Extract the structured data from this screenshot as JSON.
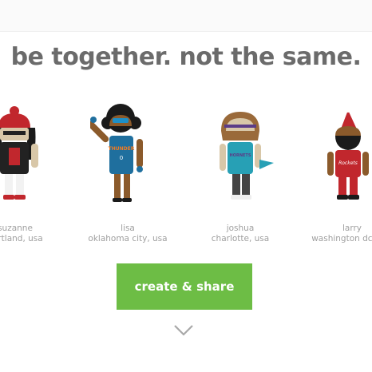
{
  "headline": "be together. not the same.",
  "characters": [
    {
      "name": "suzanne",
      "location": "portland, usa",
      "icon": "android-character-icon"
    },
    {
      "name": "lisa",
      "location": "oklahoma city, usa",
      "icon": "android-character-icon"
    },
    {
      "name": "joshua",
      "location": "charlotte, usa",
      "icon": "android-character-icon"
    },
    {
      "name": "larry",
      "location": "washington dc, usa",
      "icon": "android-character-icon"
    }
  ],
  "cta": {
    "label": "create & share"
  },
  "scroll": {
    "icon": "chevron-down-icon"
  },
  "colors": {
    "accent": "#6dbd45",
    "text": "#6b6b6b",
    "muted": "#a0a0a0"
  }
}
